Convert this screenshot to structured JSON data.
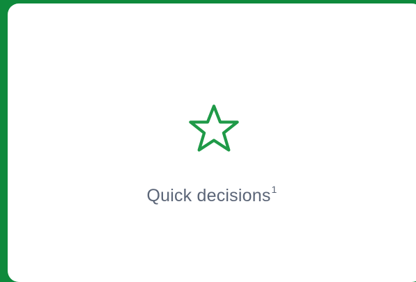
{
  "feature": {
    "icon": "star-icon",
    "label": "Quick decisions",
    "footnote_marker": "1"
  },
  "colors": {
    "frame_border": "#0e8a3c",
    "card_background": "#ffffff",
    "icon_stroke": "#1f9a48",
    "label_text": "#5b6577"
  }
}
